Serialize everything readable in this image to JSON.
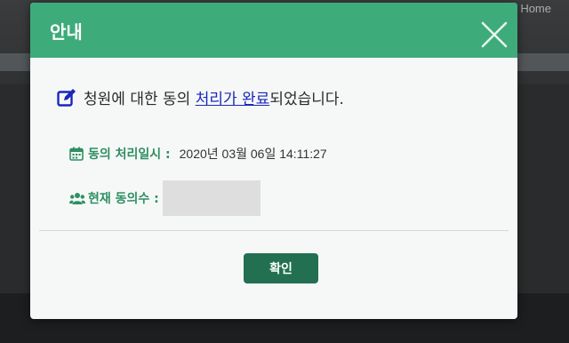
{
  "background": {
    "home_link": "Home"
  },
  "modal": {
    "title": "안내",
    "close_icon": "close-icon",
    "message": {
      "icon": "edit-icon",
      "prefix": "청원에 대한 동의",
      "link_text": "처리가 완료",
      "suffix": "되었습니다."
    },
    "processed_time": {
      "icon": "calendar-icon",
      "label": "동의 처리일시 :",
      "value": "2020년 03월 06일 14:11:27"
    },
    "current_count": {
      "icon": "users-icon",
      "label": "현재 동의수 :",
      "value": ""
    },
    "confirm_label": "확인"
  },
  "colors": {
    "header": "#3dab7a",
    "label": "#2f8f62",
    "button": "#227051",
    "link": "#1a27b8"
  }
}
